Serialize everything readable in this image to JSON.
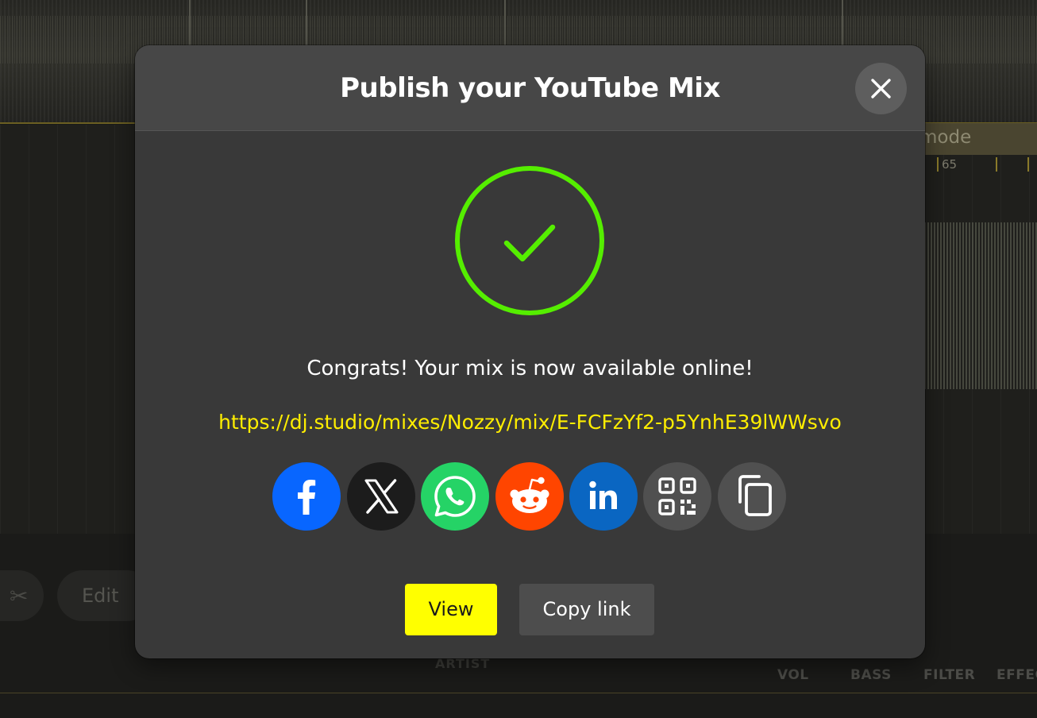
{
  "dialog": {
    "title": "Publish your YouTube Mix",
    "close_icon": "close-icon",
    "success_icon": "check-circle-icon",
    "success_color": "#55ee00",
    "message": "Congrats! Your mix is now available online!",
    "url": "https://dj.studio/mixes/Nozzy/mix/E-FCFzYf2-p5YnhE39lWWsvo",
    "url_color": "#ffee00",
    "share": [
      {
        "name": "facebook",
        "icon": "facebook-icon",
        "color": "#0866ff"
      },
      {
        "name": "x",
        "icon": "x-icon",
        "color": "#1c1c1c"
      },
      {
        "name": "whatsapp",
        "icon": "whatsapp-icon",
        "color": "#25d366"
      },
      {
        "name": "reddit",
        "icon": "reddit-icon",
        "color": "#ff4500"
      },
      {
        "name": "linkedin",
        "icon": "linkedin-icon",
        "color": "#0a66c2"
      },
      {
        "name": "qr-code",
        "icon": "qr-code-icon",
        "color": "#505050"
      },
      {
        "name": "copy",
        "icon": "copy-icon",
        "color": "#505050"
      }
    ],
    "view_label": "View",
    "view_color": "#ffff00",
    "copy_link_label": "Copy link"
  },
  "background": {
    "mode_label": "mode",
    "ruler_number": "65",
    "edit_label": "Edit",
    "scissors_icon": "scissors-icon",
    "artist_label": "ARTIST",
    "columns": [
      "VOL",
      "BASS",
      "FILTER",
      "EFFEC"
    ]
  }
}
